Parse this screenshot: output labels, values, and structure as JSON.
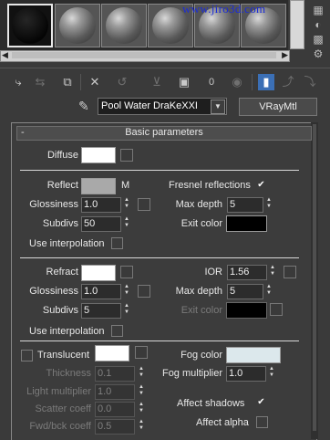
{
  "watermark": "www.jiro3d.com",
  "slots": [
    {
      "kind": "black",
      "selected": true
    },
    {
      "kind": "gray",
      "selected": false
    },
    {
      "kind": "gray",
      "selected": false
    },
    {
      "kind": "gray",
      "selected": false
    },
    {
      "kind": "gray",
      "selected": false
    },
    {
      "kind": "gray",
      "selected": false
    }
  ],
  "toolbar": {
    "icons": [
      "get-material-icon",
      "put-to-scene-icon",
      "assign-material-icon",
      "reset-map-icon",
      "make-unique-icon",
      "put-to-library-icon",
      "material-id-icon",
      "show-map-icon",
      "show-end-result-icon",
      "go-to-parent-icon",
      "go-forward-icon"
    ],
    "material_id_label": "0"
  },
  "material": {
    "name": "Pool Water DraKeXXI",
    "type": "VRayMtl"
  },
  "rollout": {
    "collapse": "-",
    "title": "Basic parameters"
  },
  "diffuse": {
    "label": "Diffuse",
    "color": "#ffffff"
  },
  "reflect": {
    "label": "Reflect",
    "color": "#a9a9a9",
    "map_label": "M",
    "fresnel_label": "Fresnel reflections",
    "fresnel_checked": "✔",
    "glossiness_label": "Glossiness",
    "glossiness": "1.0",
    "max_depth_label": "Max depth",
    "max_depth": "5",
    "subdivs_label": "Subdivs",
    "subdivs": "50",
    "exit_color_label": "Exit color",
    "exit_color": "#000000",
    "use_interp_label": "Use interpolation"
  },
  "refract": {
    "label": "Refract",
    "color": "#ffffff",
    "ior_label": "IOR",
    "ior": "1.56",
    "glossiness_label": "Glossiness",
    "glossiness": "1.0",
    "max_depth_label": "Max depth",
    "max_depth": "5",
    "subdivs_label": "Subdivs",
    "subdivs": "5",
    "exit_color_label": "Exit color",
    "exit_color": "#000000",
    "use_interp_label": "Use interpolation"
  },
  "translucent": {
    "label": "Translucent",
    "color": "#ffffff",
    "thickness_label": "Thickness",
    "thickness": "0.1",
    "light_mult_label": "Light multiplier",
    "light_mult": "1.0",
    "scatter_label": "Scatter coeff",
    "scatter": "0.0",
    "fwd_bck_label": "Fwd/bck coeff",
    "fwd_bck": "0.5",
    "fog_color_label": "Fog color",
    "fog_color": "#dce8ec",
    "fog_mult_label": "Fog multiplier",
    "fog_mult": "1.0",
    "affect_shadows_label": "Affect shadows",
    "affect_shadows_checked": "✔",
    "affect_alpha_label": "Affect alpha"
  }
}
